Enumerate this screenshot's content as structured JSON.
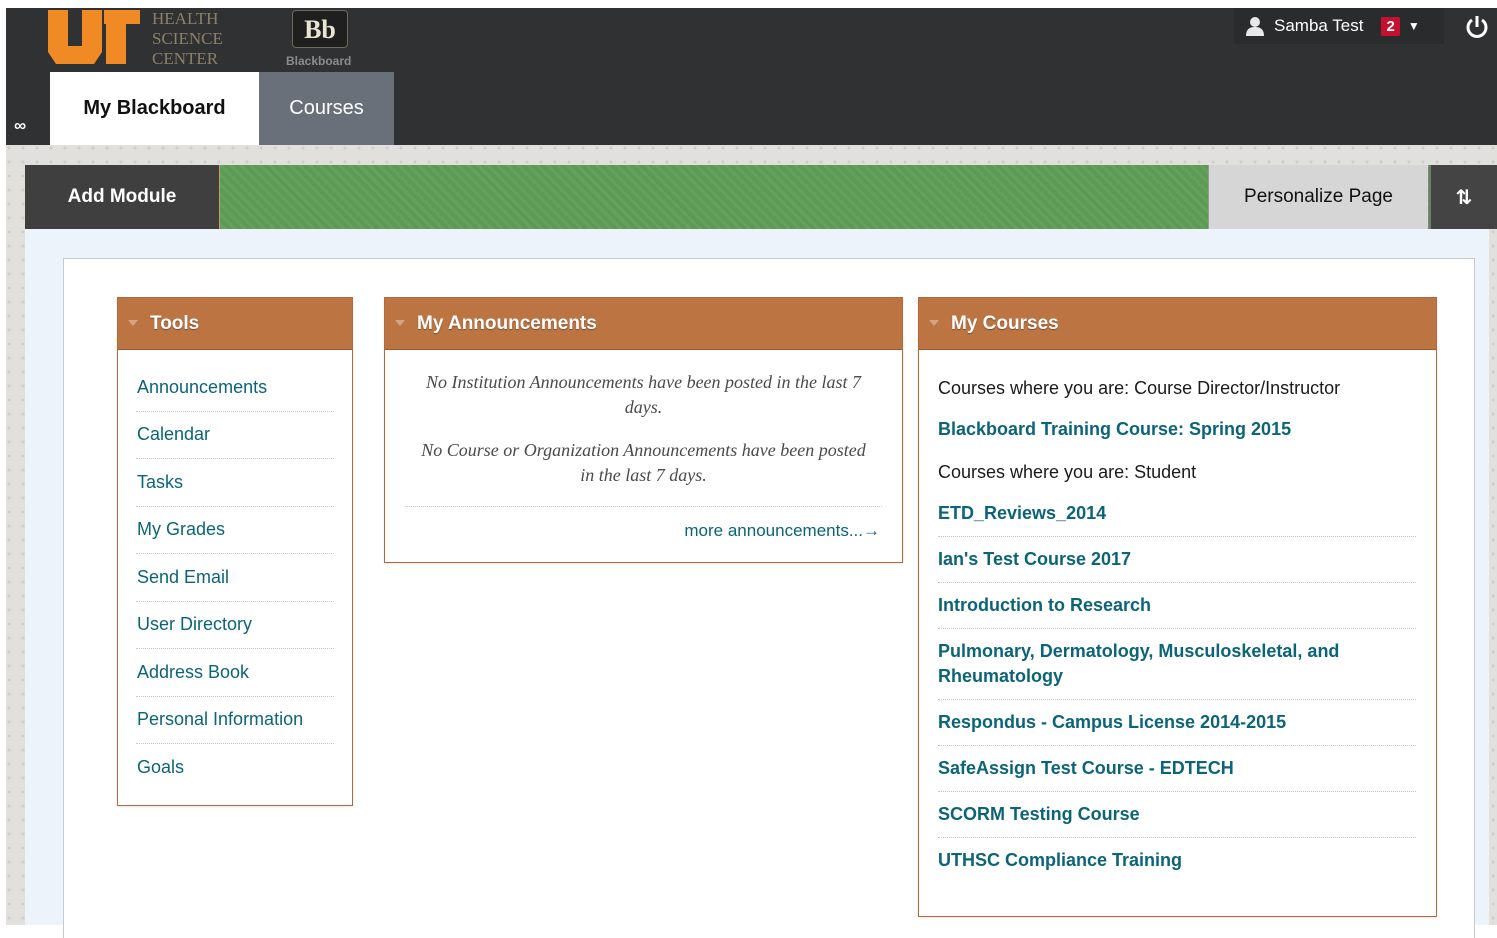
{
  "header": {
    "brand": {
      "initials": "UT",
      "line1": "HEALTH",
      "line2": "SCIENCE",
      "line3": "CENTER"
    },
    "bb_logo": {
      "mark": "Bb",
      "label": "Blackboard"
    },
    "user_name": "Samba Test",
    "notification_count": "2",
    "tabs": [
      {
        "label": "My Blackboard",
        "active": true
      },
      {
        "label": "Courses",
        "active": false
      }
    ]
  },
  "actionbar": {
    "add_module": "Add Module",
    "personalize": "Personalize Page",
    "reorder_icon": "⇅"
  },
  "tools": {
    "title": "Tools",
    "items": [
      "Announcements",
      "Calendar",
      "Tasks",
      "My Grades",
      "Send Email",
      "User Directory",
      "Address Book",
      "Personal Information",
      "Goals"
    ]
  },
  "announcements": {
    "title": "My Announcements",
    "msg1": "No Institution Announcements have been posted in the last 7 days.",
    "msg2": "No Course or Organization Announcements have been posted in the last 7 days.",
    "more": "more announcements...→"
  },
  "courses": {
    "title": "My Courses",
    "instructor_heading": "Courses where you are: Course Director/Instructor",
    "instructor_courses": [
      "Blackboard Training Course: Spring 2015"
    ],
    "student_heading": "Courses where you are: Student",
    "student_courses": [
      "ETD_Reviews_2014",
      "Ian's Test Course 2017",
      "Introduction to Research",
      "Pulmonary, Dermatology, Musculoskeletal, and Rheumatology",
      "Respondus - Campus License 2014-2015",
      "SafeAssign Test Course - EDTECH",
      "SCORM Testing Course",
      "UTHSC Compliance Training"
    ]
  },
  "colors": {
    "header_bg": "#303133",
    "action_green": "#5b9b54",
    "module_header": "#bc7443",
    "link": "#0b6478",
    "badge_red": "#c8102e"
  },
  "icons": {
    "user": "person-icon",
    "caret": "caret-down-icon",
    "power": "power-icon",
    "link": "link-icon",
    "twisty": "collapse-triangle-icon"
  }
}
